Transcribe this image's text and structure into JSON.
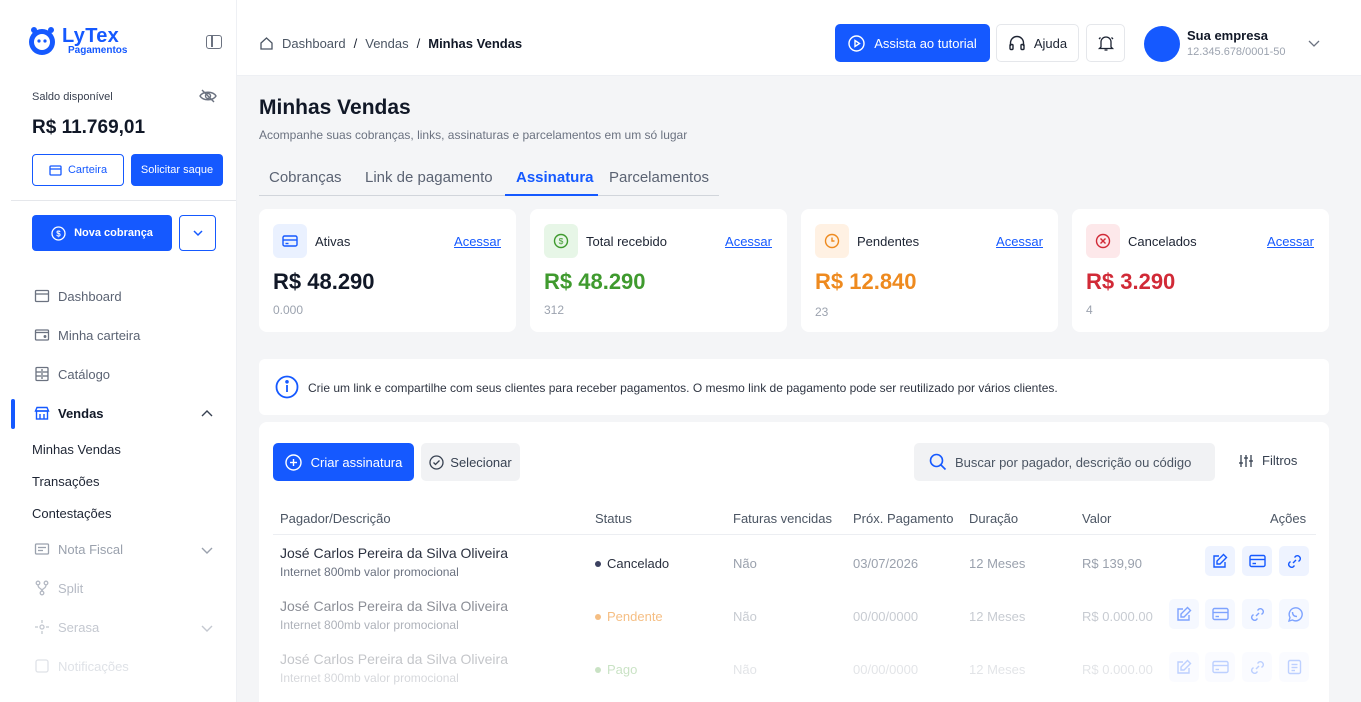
{
  "brand": {
    "name": "LyTex",
    "tagline": "Pagamentos"
  },
  "sidebar": {
    "balance_label": "Saldo disponível",
    "balance_value": "R$ 11.769,01",
    "wallet_button": "Carteira",
    "withdraw_button": "Solicitar saque",
    "new_charge_button": "Nova cobrança",
    "nav": [
      {
        "label": "Dashboard",
        "icon": "calendar-icon"
      },
      {
        "label": "Minha carteira",
        "icon": "wallet-icon"
      },
      {
        "label": "Catálogo",
        "icon": "catalog-icon"
      },
      {
        "label": "Vendas",
        "icon": "store-icon"
      },
      {
        "label": "Nota Fiscal",
        "icon": "invoice-icon"
      },
      {
        "label": "Split",
        "icon": "split-icon"
      },
      {
        "label": "Serasa",
        "icon": "serasa-icon"
      },
      {
        "label": "Notificações",
        "icon": "notification-icon"
      }
    ],
    "vendas_sub": [
      "Minhas Vendas",
      "Transações",
      "Contestações"
    ]
  },
  "topbar": {
    "breadcrumb": [
      "Dashboard",
      "Vendas",
      "Minhas Vendas"
    ],
    "tutorial_button": "Assista ao tutorial",
    "help_button": "Ajuda",
    "company_name": "Sua empresa",
    "company_doc": "12.345.678/0001-50"
  },
  "page": {
    "title": "Minhas Vendas",
    "subtitle": "Acompanhe suas cobranças, links, assinaturas e parcelamentos em um só lugar",
    "tabs": [
      "Cobranças",
      "Link de pagamento",
      "Assinatura",
      "Parcelamentos"
    ],
    "active_tab": "Assinatura"
  },
  "cards": [
    {
      "label": "Ativas",
      "link": "Acessar",
      "value": "R$ 48.290",
      "count": "0.000",
      "color": "#111827",
      "icon_bg": "#eaf1ff",
      "icon_color": "#1559ff"
    },
    {
      "label": "Total recebido",
      "link": "Acessar",
      "value": "R$ 48.290",
      "count": "312",
      "color": "#3f9a2e",
      "icon_bg": "#e7f6e7",
      "icon_color": "#3f9a2e"
    },
    {
      "label": "Pendentes",
      "link": "Acessar",
      "value": "R$ 12.840",
      "count": "23",
      "color": "#ee8a1f",
      "icon_bg": "#fff1e3",
      "icon_color": "#ee8a1f"
    },
    {
      "label": "Cancelados",
      "link": "Acessar",
      "value": "R$ 3.290",
      "count": "4",
      "color": "#d12a37",
      "icon_bg": "#fde8ea",
      "icon_color": "#d12a37"
    }
  ],
  "info": "Crie um link e compartilhe com seus clientes para receber pagamentos. O mesmo link de pagamento pode ser reutilizado por vários clientes.",
  "table": {
    "create_button": "Criar assinatura",
    "select_button": "Selecionar",
    "search_placeholder": "Buscar por pagador, descrição ou código",
    "filters_label": "Filtros",
    "columns": [
      "Pagador/Descrição",
      "Status",
      "Faturas vencidas",
      "Próx. Pagamento",
      "Duração",
      "Valor",
      "Ações"
    ],
    "rows": [
      {
        "payer": "José Carlos Pereira da Silva Oliveira",
        "desc": "Internet 800mb valor promocional",
        "status": "Cancelado",
        "status_color": "#3b4160",
        "overdue": "Não",
        "next": "03/07/2026",
        "duration": "12 Meses",
        "value": "R$ 139,90"
      },
      {
        "payer": "José Carlos Pereira da Silva Oliveira",
        "desc": "Internet 800mb valor promocional",
        "status": "Pendente",
        "status_color": "#ee8a1f",
        "overdue": "Não",
        "next": "00/00/0000",
        "duration": "12 Meses",
        "value": "R$ 0.000.00"
      },
      {
        "payer": "José Carlos Pereira da Silva Oliveira",
        "desc": "Internet 800mb valor promocional",
        "status": "Pago",
        "status_color": "#3f9a2e",
        "overdue": "Não",
        "next": "00/00/0000",
        "duration": "12 Meses",
        "value": "R$ 0.000.00"
      }
    ]
  },
  "colors": {
    "primary": "#1559ff"
  }
}
